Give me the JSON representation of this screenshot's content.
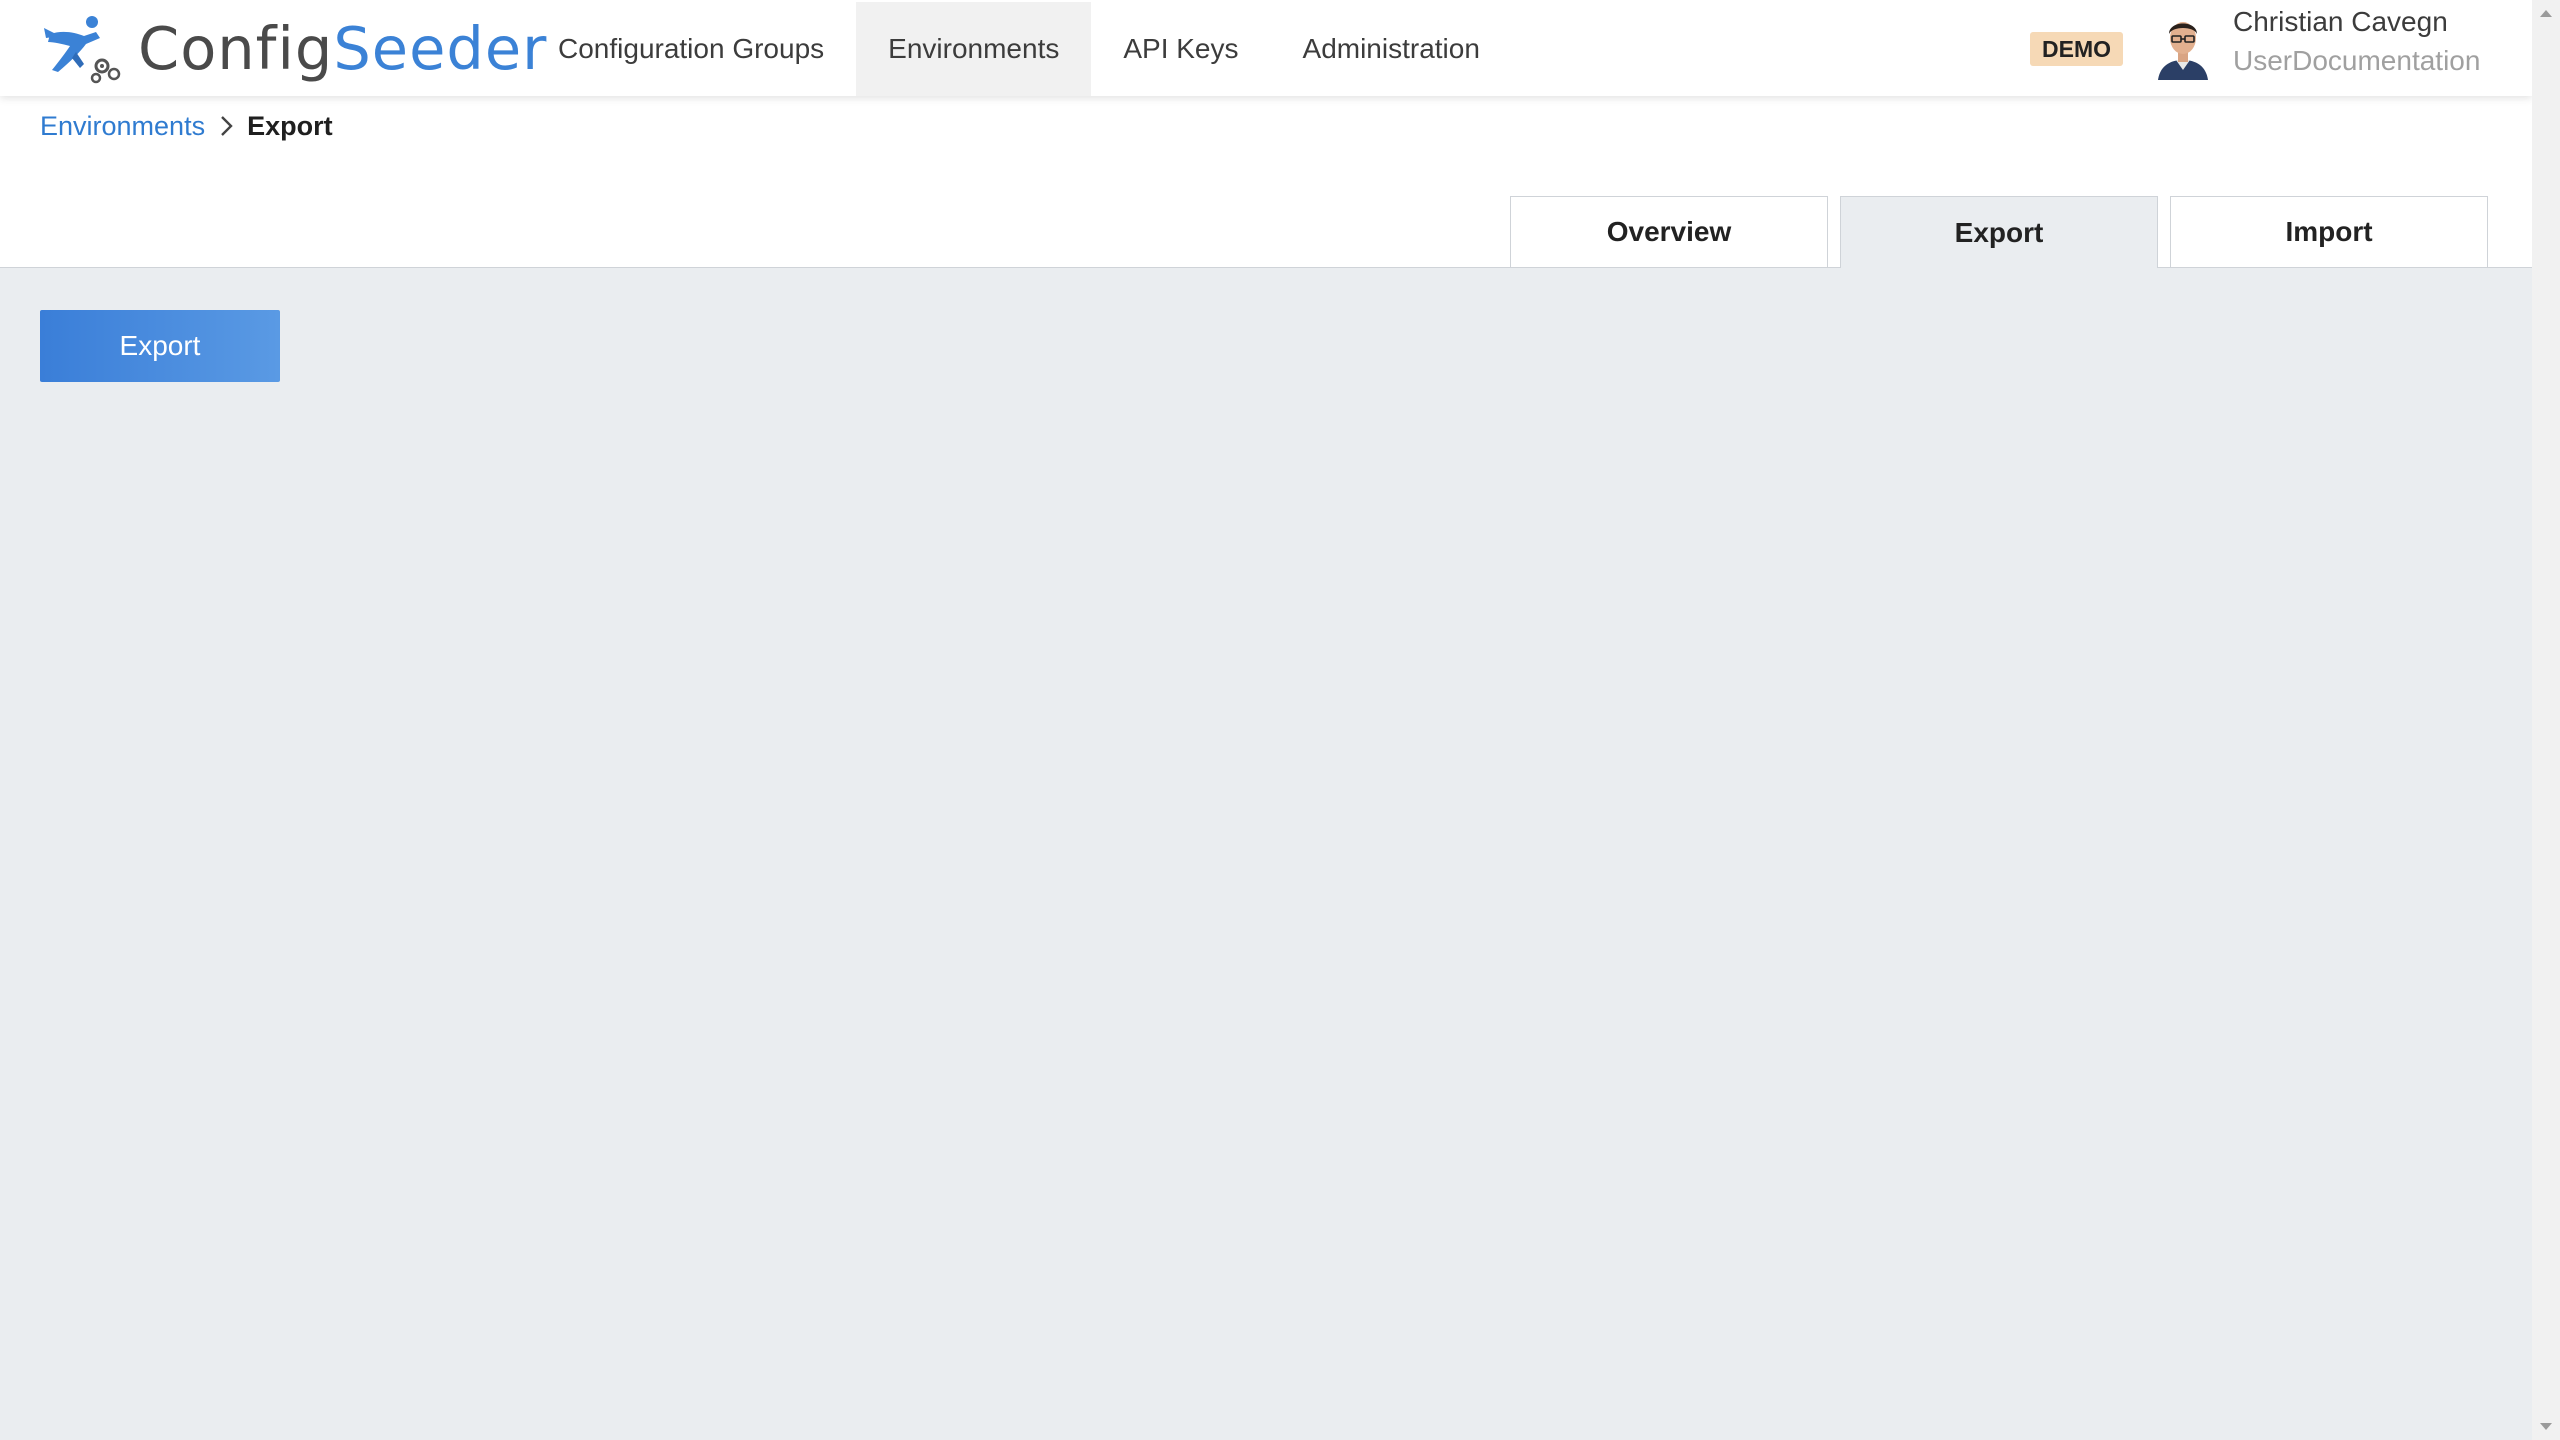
{
  "header": {
    "logo": {
      "part1": "Config",
      "part2": "Seeder"
    },
    "nav": [
      {
        "label": "Configuration Groups",
        "active": false
      },
      {
        "label": "Environments",
        "active": true
      },
      {
        "label": "API Keys",
        "active": false
      },
      {
        "label": "Administration",
        "active": false
      }
    ],
    "badge": "DEMO",
    "user": {
      "name": "Christian Cavegn",
      "organization": "UserDocumentation"
    }
  },
  "breadcrumb": {
    "parent": "Environments",
    "current": "Export"
  },
  "tabs": [
    {
      "label": "Overview",
      "active": false
    },
    {
      "label": "Export",
      "active": true
    },
    {
      "label": "Import",
      "active": false
    }
  ],
  "content": {
    "export_button": "Export"
  },
  "colors": {
    "brand_blue": "#3b82d6",
    "link_blue": "#2f7bd0",
    "content_background": "#eaedf0",
    "badge_background": "#f6d9b6"
  },
  "icons": {
    "logo": "seeder-logo-icon",
    "breadcrumb_separator": "chevron-right-icon",
    "avatar": "user-avatar"
  }
}
